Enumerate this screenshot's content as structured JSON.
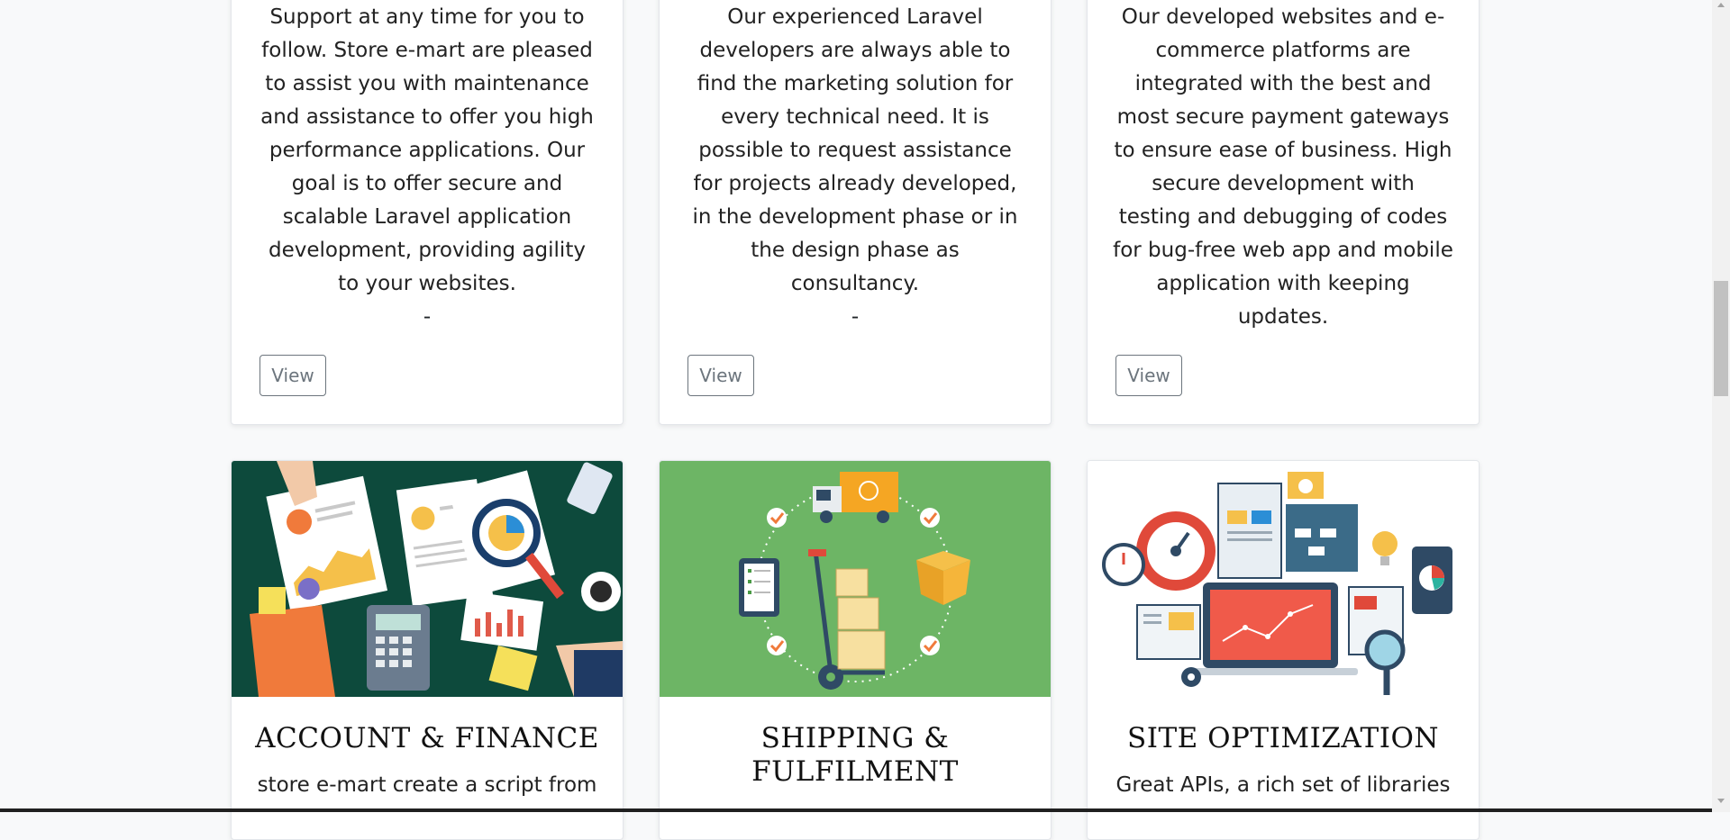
{
  "cards_top": [
    {
      "lines": [
        "Support at any time for you to",
        "follow. Store e-mart are pleased",
        "to assist you with maintenance",
        "and assistance to offer you high",
        "performance applications. Our",
        "goal is to offer secure and",
        "scalable Laravel application",
        "development, providing agility",
        "to your websites."
      ],
      "dash": "-",
      "button": "View"
    },
    {
      "lines": [
        "Our experienced Laravel",
        "developers are always able to",
        "find the marketing solution for",
        "every technical need. It is",
        "possible to request assistance",
        "for projects already developed,",
        "in the development phase or in",
        "the design phase as",
        "consultancy."
      ],
      "dash": "-",
      "button": "View"
    },
    {
      "lines": [
        "Our developed websites and e-",
        "commerce platforms are",
        "integrated with the best and",
        "most secure payment gateways",
        "to ensure ease of business. High",
        "secure development with",
        "testing and debugging of codes",
        "for bug-free web app and mobile",
        "application with keeping",
        "updates."
      ],
      "dash": "",
      "button": "View"
    }
  ],
  "cards_bottom": [
    {
      "title_lines": [
        "ACCOUNT & FINANCE"
      ],
      "desc": "store e-mart create a script from",
      "image_icon": "finance-illustration",
      "bg": "#0d4a3c"
    },
    {
      "title_lines": [
        "SHIPPING &",
        "FULFILMENT"
      ],
      "desc": "",
      "image_icon": "shipping-illustration",
      "bg": "#6db565"
    },
    {
      "title_lines": [
        "SITE OPTIMIZATION"
      ],
      "desc": "Great APIs, a rich set of libraries",
      "image_icon": "optimization-illustration",
      "bg": "#ffffff"
    }
  ]
}
